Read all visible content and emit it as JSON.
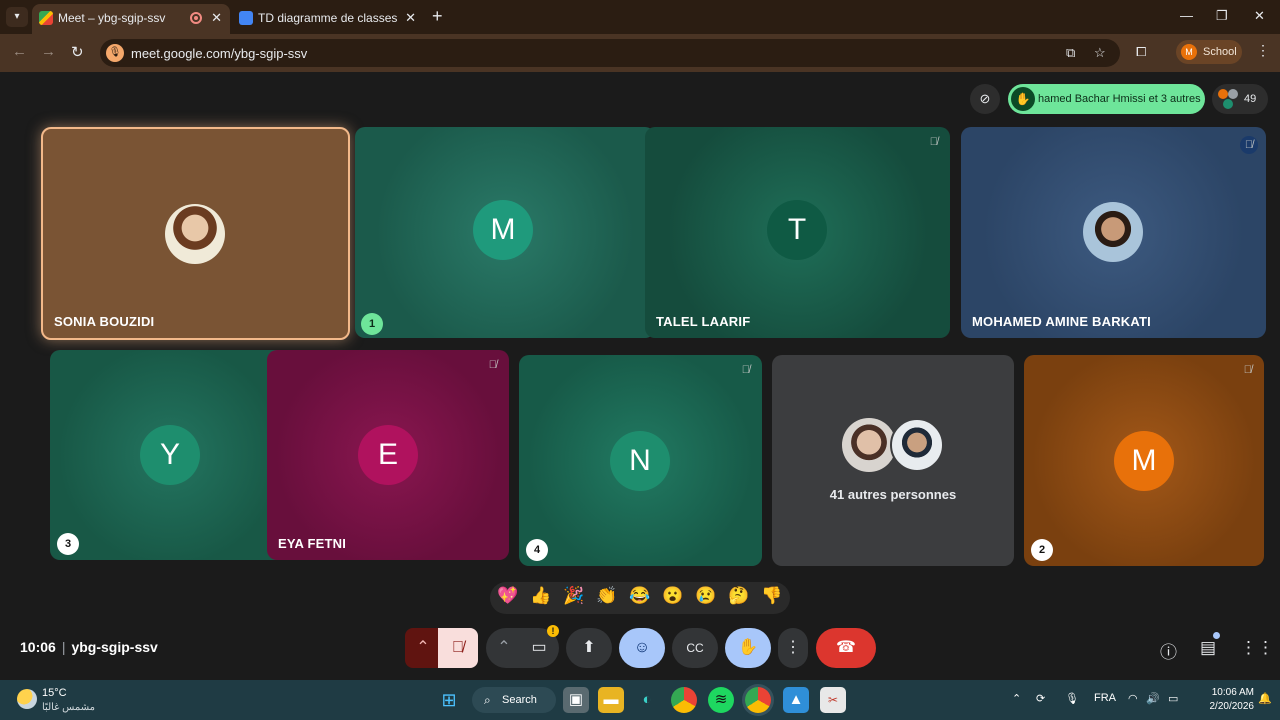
{
  "browser": {
    "tabs": [
      {
        "title": "Meet – ybg-sgip-ssv"
      },
      {
        "title": "TD diagramme de classes"
      }
    ],
    "url": "meet.google.com/ybg-sgip-ssv",
    "profile_label": "School",
    "profile_initial": "M"
  },
  "meet": {
    "hands_raised_text": "hamed Bachar Hmissi et 3 autres",
    "participant_count": "49",
    "tiles": [
      {
        "name": "SONIA BOUZIDI",
        "initial": "",
        "active_speaker": true
      },
      {
        "name": "",
        "initial": "M",
        "hand_order": "1"
      },
      {
        "name": "TALEL LAARIF",
        "initial": "T",
        "muted": true
      },
      {
        "name": "MOHAMED AMINE BARKATI",
        "initial": "",
        "muted": true
      },
      {
        "name": "",
        "initial": "Y",
        "hand_order": "3"
      },
      {
        "name": "EYA FETNI",
        "initial": "E",
        "muted": true
      },
      {
        "name": "",
        "initial": "N",
        "muted": true,
        "hand_order": "4"
      },
      {
        "name": "41 autres personnes",
        "initial": ""
      },
      {
        "name": "",
        "initial": "M",
        "muted": true,
        "hand_order": "2"
      }
    ],
    "reactions": [
      "💖",
      "👍",
      "🎉",
      "👏",
      "😂",
      "😮",
      "😢",
      "🤔",
      "👎"
    ],
    "time": "10:06",
    "meeting_code": "ybg-sgip-ssv",
    "colors": {
      "hand_green": "#6ee59a",
      "leave_red": "#dc362e",
      "active_blue": "#a8c7fa"
    }
  },
  "taskbar": {
    "temperature": "15°C",
    "weather_desc": "مشمس غالبًا",
    "search_label": "Search",
    "language": "FRA",
    "clock_time": "10:06 AM",
    "clock_date": "2/20/2026"
  }
}
